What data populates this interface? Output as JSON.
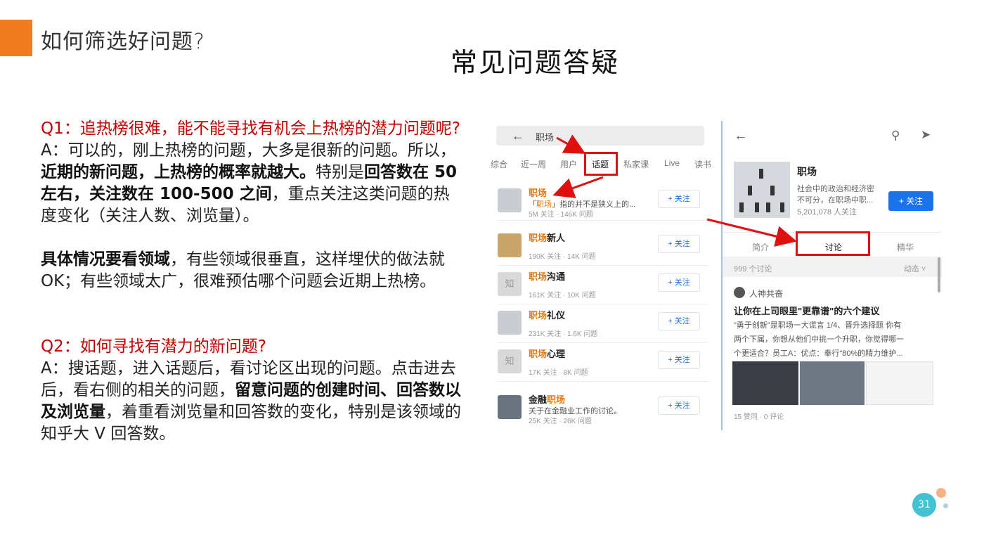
{
  "header": {
    "section_title": "如何筛选好问题?",
    "slide_title": "常见问题答疑"
  },
  "q1": {
    "question": "Q1：追热榜很难，能不能寻找有机会上热榜的潜力问题呢?",
    "answer_pre": "A：可以的，刚上热榜的问题，大多是很新的问题。所以，",
    "answer_bold1": "近期的新问题，上热榜的概率就越大。",
    "answer_mid": "特别是",
    "answer_bold2": "回答数在 50 左右，关注数在 100-500 之间",
    "answer_post": "，重点关注这类问题的热度变化（关注人数、浏览量）。",
    "detail_bold": "具体情况要看领域",
    "detail_rest": "，有些领域很垂直，这样埋伏的做法就OK；有些领域太广，很难预估哪个问题会近期上热榜。"
  },
  "q2": {
    "question": "Q2：如何寻找有潜力的新问题?",
    "answer_pre": "A：搜话题，进入话题后，看讨论区出现的问题。点击进去后，看右侧的相关的问题，",
    "answer_bold": "留意问题的创建时间、回答数以及浏览量",
    "answer_post": "，着重看浏览量和回答数的变化，特别是该领域的知乎大 V 回答数。"
  },
  "left_screen": {
    "search_text": "职场",
    "tabs": [
      "综合",
      "近一周",
      "用户",
      "话题",
      "私家课",
      "Live",
      "读书"
    ],
    "follow_label": "+ 关注",
    "topics": [
      {
        "hl": "职场",
        "name_rest": "",
        "desc_pre": "「",
        "desc_hl": "职场",
        "desc_post": "」指的并不是狭义上的...",
        "meta": "5M 关注 · 146K 问题"
      },
      {
        "hl": "职场",
        "name_rest": "新人",
        "desc_pre": "",
        "desc_hl": "",
        "desc_post": "",
        "meta": "190K 关注 · 14K 问题"
      },
      {
        "hl": "职场",
        "name_rest": "沟通",
        "desc_pre": "",
        "desc_hl": "",
        "desc_post": "",
        "meta": "161K 关注 · 10K 问题"
      },
      {
        "hl": "职场",
        "name_rest": "礼仪",
        "desc_pre": "",
        "desc_hl": "",
        "desc_post": "",
        "meta": "231K 关注 · 1.6K 问题"
      },
      {
        "hl": "职场",
        "name_rest": "心理",
        "desc_pre": "",
        "desc_hl": "",
        "desc_post": "",
        "meta": "17K 关注 · 8K 问题"
      },
      {
        "hl": "金融",
        "name_rest": "职场",
        "desc_pre": "关于在金融业工作的讨论。",
        "desc_hl": "",
        "desc_post": "",
        "meta": "25K 关注 · 26K 问题"
      }
    ],
    "placeholder_glyph": "知"
  },
  "right_screen": {
    "topic_name": "职场",
    "desc_line1": "社会中的政治和经济密",
    "desc_line2": "不可分，在职场中职...",
    "followers": "5,201,078 人关注",
    "follow_button": "+ 关注",
    "tabs": [
      "简介",
      "讨论",
      "精华"
    ],
    "discussion_count": "999 个讨论",
    "sort_label": "动态 ˅",
    "post_author": "人神共奋",
    "post_title": "让你在上司眼里\"更靠谱\"的六个建议",
    "post_lines": [
      "\"勇于创新\"是职场一大谎言 1/4、晋升选择题 你有",
      "两个下属，你想从他们中挑一个升职，你觉得哪一",
      "个更适合？员工A：优点：奉行\"80%的精力维护..."
    ],
    "post_stats": "15 赞同 · 0 评论"
  },
  "footer": {
    "page_number": "31"
  },
  "colors": {
    "accent": "#f07c22",
    "question_red": "#c00000",
    "annotation_red": "#e01010",
    "zhihu_blue": "#1a73e8",
    "page_badge": "#43c2d4"
  }
}
